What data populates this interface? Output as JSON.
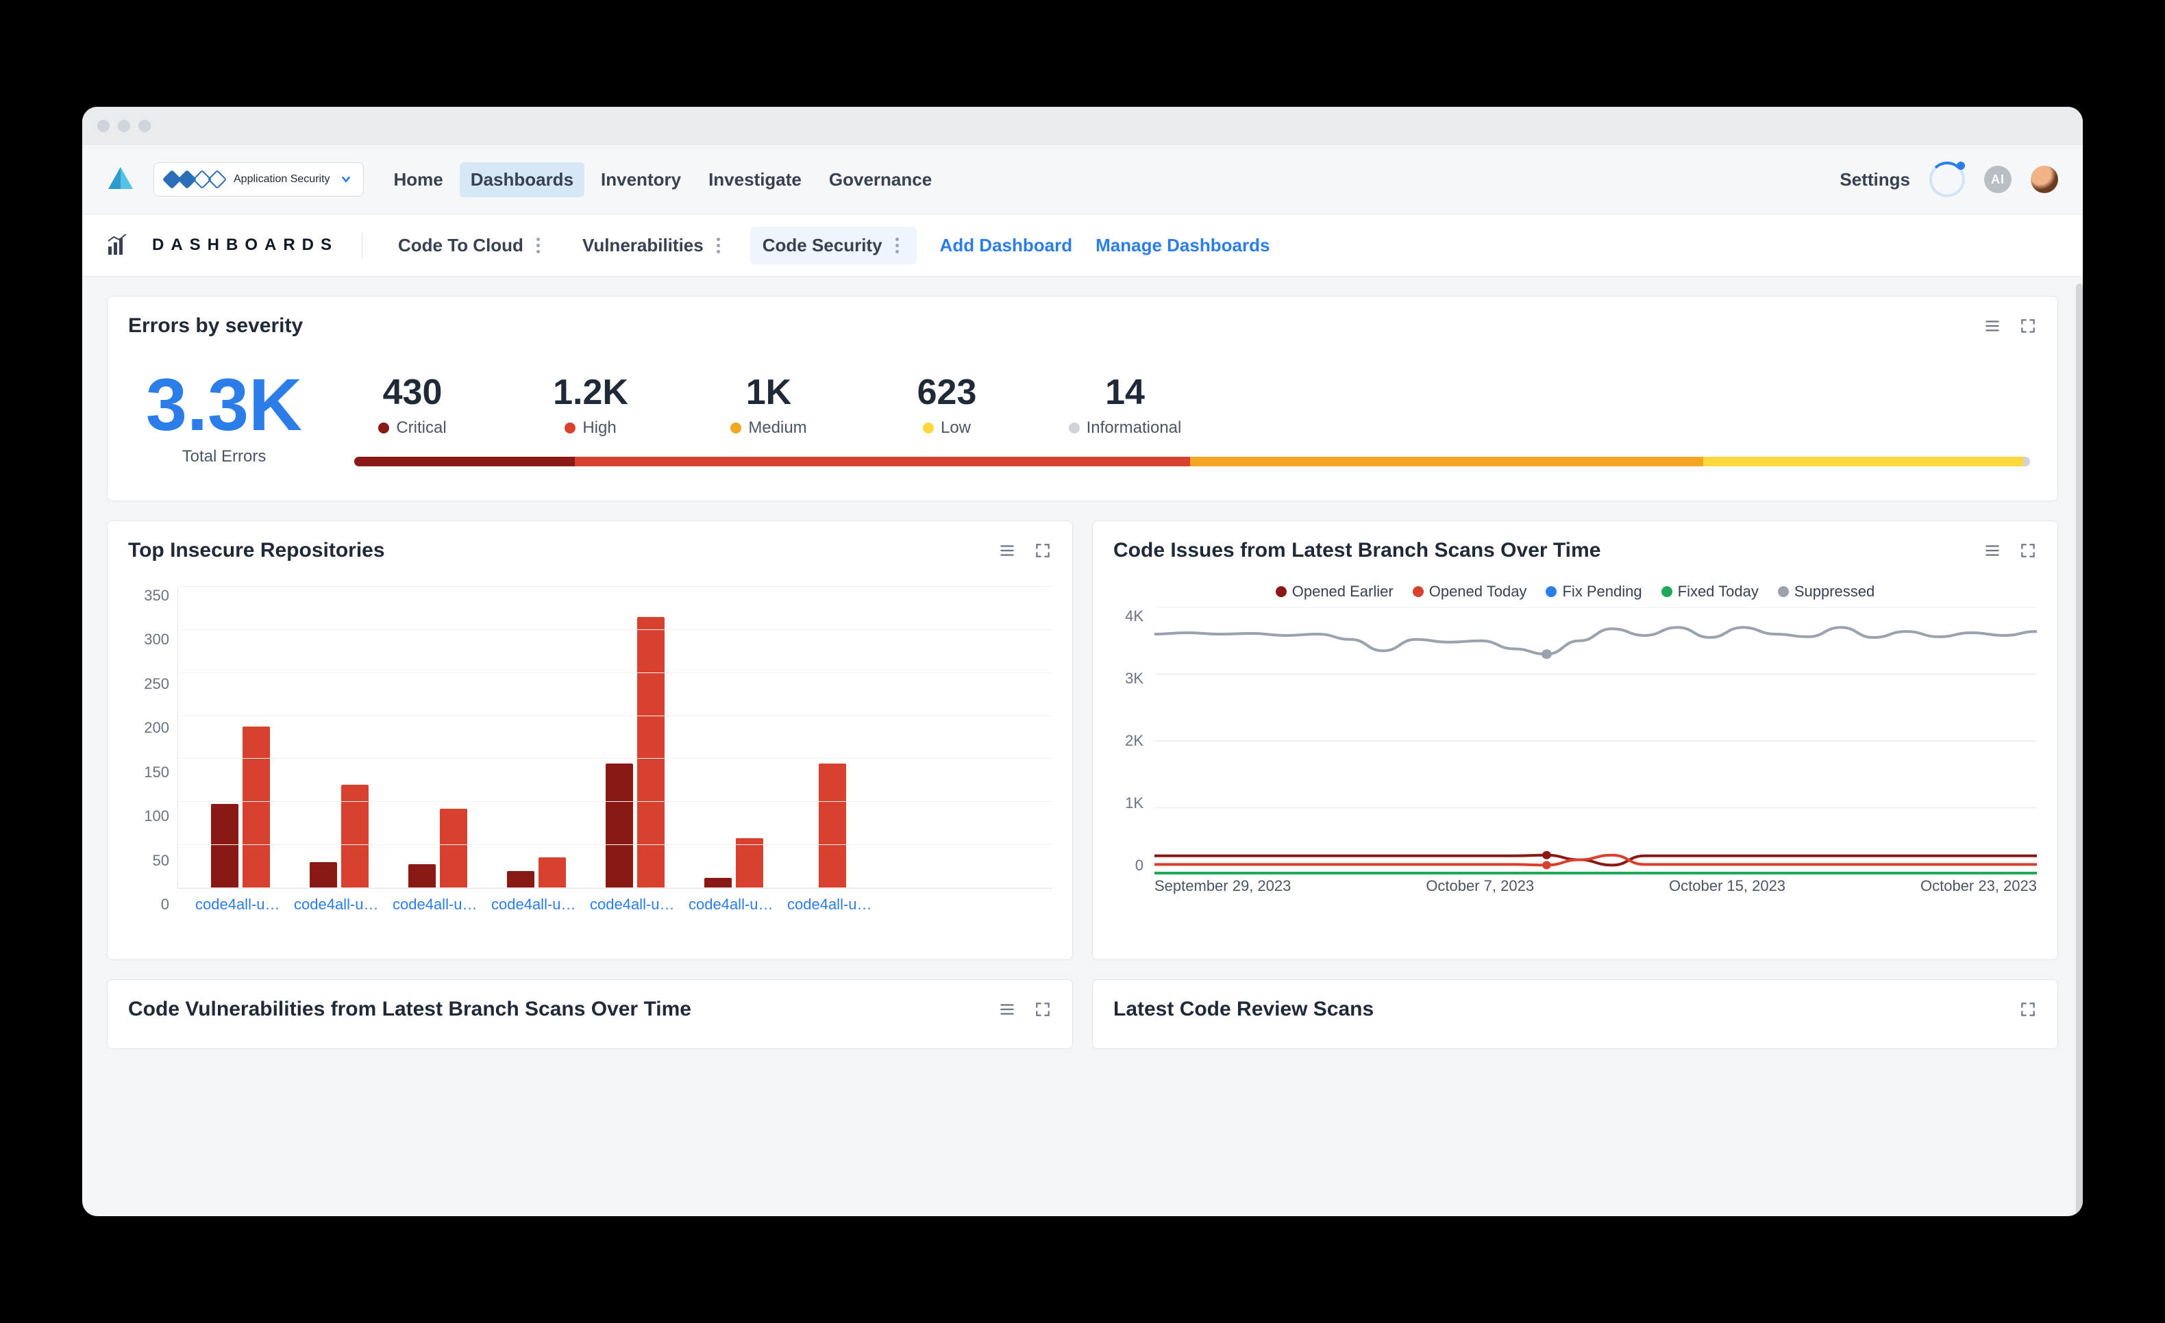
{
  "window": {
    "space_label": "Application Security"
  },
  "nav": {
    "items": [
      "Home",
      "Dashboards",
      "Inventory",
      "Investigate",
      "Governance"
    ],
    "active": "Dashboards",
    "settings": "Settings",
    "ai": "AI"
  },
  "subbar": {
    "label": "DASHBOARDS",
    "tabs": [
      {
        "label": "Code To Cloud",
        "active": false
      },
      {
        "label": "Vulnerabilities",
        "active": false
      },
      {
        "label": "Code Security",
        "active": true
      }
    ],
    "add": "Add Dashboard",
    "manage": "Manage Dashboards"
  },
  "severity": {
    "title": "Errors by severity",
    "total_value": "3.3K",
    "total_label": "Total Errors",
    "items": [
      {
        "value": "430",
        "label": "Critical",
        "color": "#8a1814"
      },
      {
        "value": "1.2K",
        "label": "High",
        "color": "#d7412e"
      },
      {
        "value": "1K",
        "label": "Medium",
        "color": "#f5a524"
      },
      {
        "value": "623",
        "label": "Low",
        "color": "#ffd83d"
      },
      {
        "value": "14",
        "label": "Informational",
        "color": "#cfd3d8"
      }
    ],
    "bar_weights": [
      430,
      1200,
      1000,
      623,
      14
    ]
  },
  "repos": {
    "title": "Top Insecure Repositories"
  },
  "issues": {
    "title": "Code Issues from Latest Branch Scans Over Time",
    "legend": [
      {
        "label": "Opened Earlier",
        "color": "#8a1814"
      },
      {
        "label": "Opened Today",
        "color": "#d7412e"
      },
      {
        "label": "Fix Pending",
        "color": "#2b7de9"
      },
      {
        "label": "Fixed Today",
        "color": "#1fa858"
      },
      {
        "label": "Suppressed",
        "color": "#9aa2ad"
      }
    ]
  },
  "partials": {
    "left_title": "Code Vulnerabilities from Latest Branch Scans Over Time",
    "right_title": "Latest Code Review Scans"
  },
  "chart_data": [
    {
      "id": "top_insecure_repositories",
      "type": "bar",
      "title": "Top Insecure Repositories",
      "ylim": [
        0,
        350
      ],
      "yticks": [
        0,
        50,
        100,
        150,
        200,
        250,
        300,
        350
      ],
      "categories": [
        "code4all-user/...",
        "code4all-user/...",
        "code4all-user/...",
        "code4all-user/...",
        "code4all-user/...",
        "code4all-user/...",
        "code4all-user/..."
      ],
      "series": [
        {
          "name": "dark",
          "color": "#8a1814",
          "values": [
            98,
            30,
            28,
            20,
            145,
            12,
            0
          ]
        },
        {
          "name": "light",
          "color": "#d7412e",
          "values": [
            188,
            120,
            92,
            36,
            315,
            58,
            145
          ]
        }
      ]
    },
    {
      "id": "code_issues_over_time",
      "type": "line",
      "title": "Code Issues from Latest Branch Scans Over Time",
      "ylim": [
        0,
        4000
      ],
      "yticks": [
        "0",
        "1K",
        "2K",
        "3K",
        "4K"
      ],
      "x_labels": [
        "September 29, 2023",
        "October 7, 2023",
        "October 15, 2023",
        "October 23, 2023"
      ],
      "x": [
        0,
        1,
        2,
        3,
        4,
        5,
        6,
        7,
        8,
        9,
        10,
        11,
        12,
        13,
        14,
        15,
        16,
        17,
        18,
        19,
        20,
        21,
        22,
        23,
        24,
        25,
        26,
        27
      ],
      "series": [
        {
          "name": "Suppressed",
          "color": "#9aa2ad",
          "values": [
            3600,
            3620,
            3600,
            3610,
            3580,
            3600,
            3520,
            3350,
            3520,
            3480,
            3500,
            3380,
            3300,
            3500,
            3680,
            3580,
            3700,
            3550,
            3700,
            3600,
            3560,
            3700,
            3550,
            3640,
            3560,
            3620,
            3580,
            3640
          ]
        },
        {
          "name": "Opened Earlier",
          "color": "#8a1814",
          "values": [
            280,
            280,
            280,
            280,
            280,
            280,
            280,
            280,
            280,
            280,
            280,
            280,
            290,
            220,
            140,
            280,
            280,
            280,
            280,
            280,
            280,
            280,
            280,
            280,
            280,
            280,
            280,
            280
          ]
        },
        {
          "name": "Opened Today",
          "color": "#d7412e",
          "values": [
            150,
            150,
            150,
            150,
            150,
            150,
            150,
            150,
            150,
            150,
            150,
            150,
            140,
            220,
            290,
            150,
            150,
            150,
            150,
            150,
            150,
            150,
            150,
            150,
            150,
            150,
            150,
            150
          ]
        },
        {
          "name": "Fix Pending",
          "color": "#2b7de9",
          "values": [
            20,
            20,
            20,
            20,
            20,
            20,
            20,
            20,
            20,
            20,
            20,
            20,
            20,
            20,
            20,
            20,
            20,
            20,
            20,
            20,
            20,
            20,
            20,
            20,
            20,
            20,
            20,
            20
          ]
        },
        {
          "name": "Fixed Today",
          "color": "#1fa858",
          "values": [
            20,
            20,
            20,
            20,
            20,
            20,
            20,
            20,
            20,
            20,
            20,
            20,
            20,
            20,
            20,
            20,
            20,
            20,
            20,
            20,
            20,
            20,
            20,
            20,
            20,
            20,
            20,
            20
          ]
        }
      ],
      "marker": {
        "series": "Suppressed",
        "x": 12,
        "y": 3300
      }
    }
  ]
}
